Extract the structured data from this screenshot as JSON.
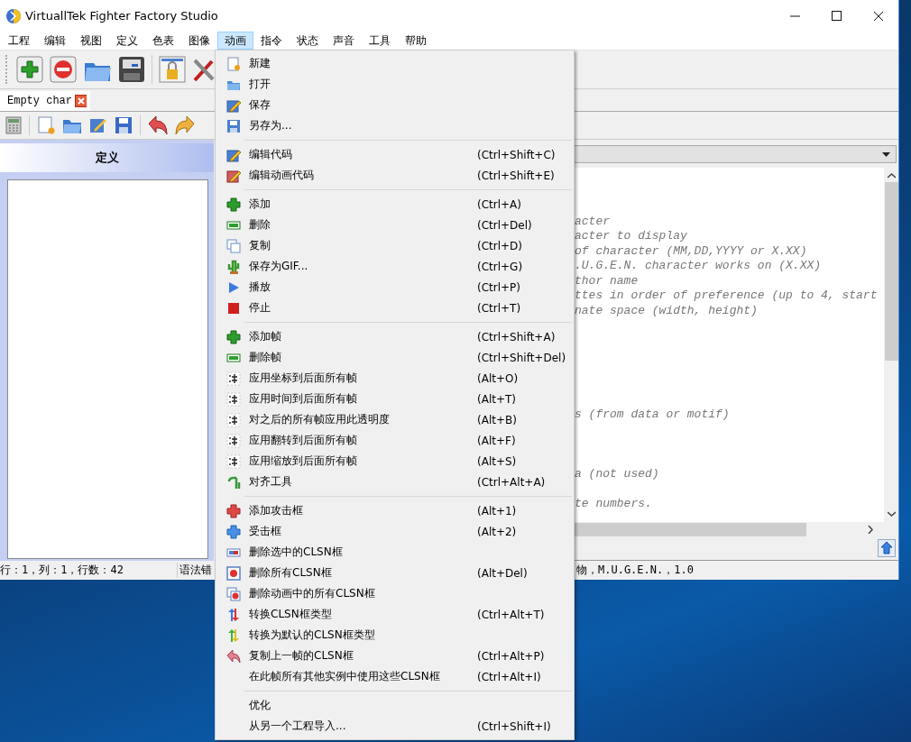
{
  "window": {
    "title": "VirtuallTek Fighter Factory Studio"
  },
  "menu_bar": [
    {
      "label": "工程",
      "selected": false
    },
    {
      "label": "编辑",
      "selected": false
    },
    {
      "label": "视图",
      "selected": false
    },
    {
      "label": "定义",
      "selected": false
    },
    {
      "label": "色表",
      "selected": false
    },
    {
      "label": "图像",
      "selected": false
    },
    {
      "label": "动画",
      "selected": true
    },
    {
      "label": "指令",
      "selected": false
    },
    {
      "label": "状态",
      "selected": false
    },
    {
      "label": "声音",
      "selected": false
    },
    {
      "label": "工具",
      "selected": false
    },
    {
      "label": "帮助",
      "selected": false
    }
  ],
  "tab": {
    "label": "Empty char"
  },
  "left_panel": {
    "header": "定义"
  },
  "editor": {
    "lines": [
      {
        "kind": "blank"
      },
      {
        "kind": "blank"
      },
      {
        "kind": "blank"
      },
      {
        "kind": "text",
        "text": "acter"
      },
      {
        "kind": "text",
        "text": "acter to display"
      },
      {
        "kind": "text",
        "text": "of character (MM,DD,YYYY or X.XX)"
      },
      {
        "kind": "text",
        "text": ".U.G.E.N. character works on (X.XX)"
      },
      {
        "kind": "text",
        "text": "thor name"
      },
      {
        "kind": "text",
        "text": "ttes in order of preference (up to 4, start"
      },
      {
        "kind": "text",
        "text": "nate space (width, height)"
      },
      {
        "kind": "blank"
      },
      {
        "kind": "blank"
      },
      {
        "kind": "blank"
      },
      {
        "kind": "blank"
      },
      {
        "kind": "blank"
      },
      {
        "kind": "blank"
      },
      {
        "kind": "text",
        "text": "s (from data or motif)"
      },
      {
        "kind": "blank"
      },
      {
        "kind": "blank"
      },
      {
        "kind": "blank"
      },
      {
        "kind": "text",
        "text": "a (not used)"
      },
      {
        "kind": "blank"
      },
      {
        "kind": "text",
        "text": "te numbers."
      }
    ]
  },
  "status_bar": {
    "position": "行：1，列：1，行数：42",
    "syntax": "语法错",
    "info": "物，M.U.G.E.N.，1.0"
  },
  "dropdown_menu": [
    {
      "kind": "item",
      "label": "新建"
    },
    {
      "kind": "item",
      "label": "打开"
    },
    {
      "kind": "item",
      "label": "保存"
    },
    {
      "kind": "item",
      "label": "另存为..."
    },
    {
      "kind": "separator"
    },
    {
      "kind": "item",
      "label": "编辑代码",
      "shortcut": "(Ctrl+Shift+C)"
    },
    {
      "kind": "item",
      "label": "编辑动画代码",
      "shortcut": "(Ctrl+Shift+E)"
    },
    {
      "kind": "separator"
    },
    {
      "kind": "item",
      "label": "添加",
      "shortcut": "(Ctrl+A)"
    },
    {
      "kind": "item",
      "label": "删除",
      "shortcut": "(Ctrl+Del)"
    },
    {
      "kind": "item",
      "label": "复制",
      "shortcut": "(Ctrl+D)"
    },
    {
      "kind": "item",
      "label": "保存为GIF...",
      "shortcut": "(Ctrl+G)"
    },
    {
      "kind": "item",
      "label": "播放",
      "shortcut": "(Ctrl+P)"
    },
    {
      "kind": "item",
      "label": "停止",
      "shortcut": "(Ctrl+T)"
    },
    {
      "kind": "separator"
    },
    {
      "kind": "item",
      "label": "添加帧",
      "shortcut": "(Ctrl+Shift+A)"
    },
    {
      "kind": "item",
      "label": "删除帧",
      "shortcut": "(Ctrl+Shift+Del)"
    },
    {
      "kind": "item",
      "label": "应用坐标到后面所有帧",
      "shortcut": "(Alt+O)"
    },
    {
      "kind": "item",
      "label": "应用时间到后面所有帧",
      "shortcut": "(Alt+T)"
    },
    {
      "kind": "item",
      "label": "对之后的所有帧应用此透明度",
      "shortcut": "(Alt+B)"
    },
    {
      "kind": "item",
      "label": "应用翻转到后面所有帧",
      "shortcut": "(Alt+F)"
    },
    {
      "kind": "item",
      "label": "应用缩放到后面所有帧",
      "shortcut": "(Alt+S)"
    },
    {
      "kind": "item",
      "label": "对齐工具",
      "shortcut": "(Ctrl+Alt+A)"
    },
    {
      "kind": "separator"
    },
    {
      "kind": "item",
      "label": "添加攻击框",
      "shortcut": "(Alt+1)"
    },
    {
      "kind": "item",
      "label": "受击框",
      "shortcut": "(Alt+2)"
    },
    {
      "kind": "item",
      "label": "删除选中的CLSN框"
    },
    {
      "kind": "item",
      "label": "删除所有CLSN框",
      "shortcut": "(Alt+Del)"
    },
    {
      "kind": "item",
      "label": "删除动画中的所有CLSN框"
    },
    {
      "kind": "item",
      "label": "转换CLSN框类型",
      "shortcut": "(Ctrl+Alt+T)"
    },
    {
      "kind": "item",
      "label": "转换为默认的CLSN框类型"
    },
    {
      "kind": "item",
      "label": "复制上一帧的CLSN框",
      "shortcut": "(Ctrl+Alt+P)"
    },
    {
      "kind": "item",
      "label": "在此帧所有其他实例中使用这些CLSN框",
      "shortcut": "(Ctrl+Alt+I)"
    },
    {
      "kind": "separator"
    },
    {
      "kind": "item",
      "label": "优化"
    },
    {
      "kind": "item",
      "label": "从另一个工程导入...",
      "shortcut": "(Ctrl+Shift+I)"
    }
  ]
}
